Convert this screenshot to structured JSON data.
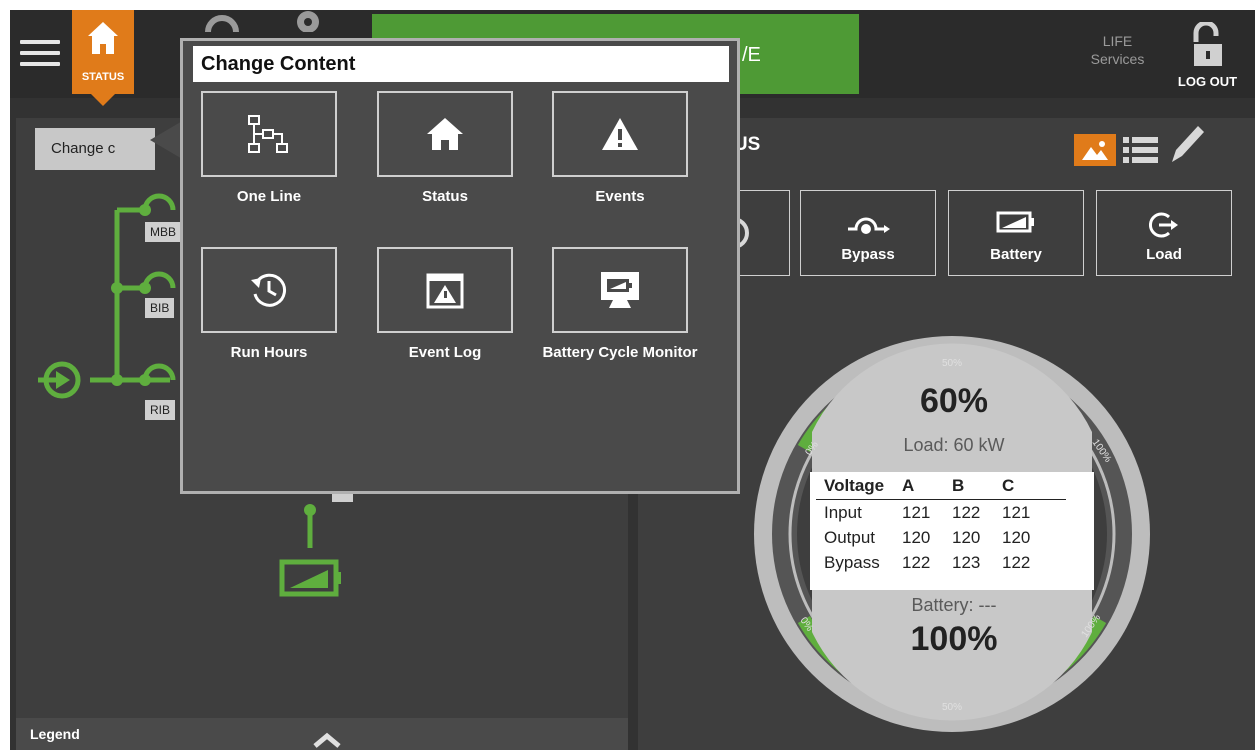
{
  "topbar": {
    "status_tab_label": "STATUS",
    "banner_text": "/E",
    "life_services": {
      "line1": "LIFE",
      "line2": "Services"
    },
    "logout_label": "LOG OUT"
  },
  "left_panel": {
    "change_tag_label": "Change c",
    "breakers": [
      "MBB",
      "BIB",
      "RIB"
    ],
    "dashes_label": "---",
    "legend_label": "Legend"
  },
  "right_panel": {
    "title": "ATUS",
    "sub_buttons": [
      "Bypass",
      "Battery",
      "Load"
    ],
    "gauge": {
      "load_percent": "60%",
      "load_text": "Load: 60 kW",
      "battery_text": "Battery: ---",
      "battery_percent": "100%",
      "scale_labels": {
        "top": "50%",
        "left_top": "0%",
        "right_top": "100%",
        "left_bottom": "0%",
        "right_bottom": "100%",
        "bottom": "50%"
      },
      "load_level": 0.6,
      "battery_level": 1.0
    },
    "voltage_table": {
      "headers": [
        "Voltage",
        "A",
        "B",
        "C"
      ],
      "rows": [
        {
          "label": "Input",
          "a": "121",
          "b": "122",
          "c": "121"
        },
        {
          "label": "Output",
          "a": "120",
          "b": "120",
          "c": "120"
        },
        {
          "label": "Bypass",
          "a": "122",
          "b": "123",
          "c": "122"
        }
      ]
    }
  },
  "popup": {
    "title": "Change Content",
    "options": [
      {
        "label": "One Line",
        "icon": "one-line-icon"
      },
      {
        "label": "Status",
        "icon": "home-icon"
      },
      {
        "label": "Events",
        "icon": "warning-icon"
      },
      {
        "label": "Run Hours",
        "icon": "history-clock-icon"
      },
      {
        "label": "Event Log",
        "icon": "event-log-icon"
      },
      {
        "label": "Battery Cycle Monitor",
        "icon": "monitor-battery-icon"
      }
    ]
  },
  "colors": {
    "accent_orange": "#e07b1a",
    "ok_green": "#4e9a35",
    "background": "#323232"
  }
}
